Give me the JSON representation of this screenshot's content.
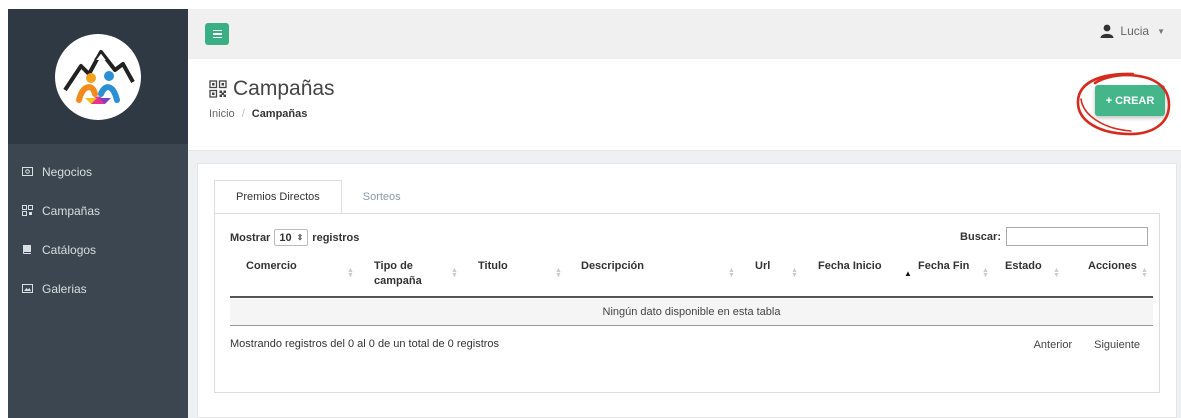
{
  "sidebar": {
    "items": [
      {
        "label": "Negocios",
        "icon": "money-icon"
      },
      {
        "label": "Campañas",
        "icon": "qrcode-icon"
      },
      {
        "label": "Catálogos",
        "icon": "book-icon"
      },
      {
        "label": "Galerias",
        "icon": "image-icon"
      }
    ]
  },
  "topbar": {
    "user_name": "Lucia"
  },
  "header": {
    "title": "Campañas",
    "breadcrumb": [
      "Inicio",
      "Campañas"
    ],
    "breadcrumb_sep": "/",
    "create_button": "+ CREAR"
  },
  "tabs": [
    {
      "label": "Premios Directos",
      "active": true
    },
    {
      "label": "Sorteos",
      "active": false
    }
  ],
  "table": {
    "length_prefix": "Mostrar",
    "length_value": "10",
    "length_suffix": "registros",
    "search_label": "Buscar:",
    "columns": [
      "Comercio",
      "Tipo de campaña",
      "Titulo",
      "Descripción",
      "Url",
      "Fecha Inicio",
      "Fecha Fin",
      "Estado",
      "Acciones"
    ],
    "empty_message": "Ningún dato disponible en esta tabla",
    "info": "Mostrando registros del 0 al 0 de un total de 0 registros",
    "prev": "Anterior",
    "next": "Siguiente"
  },
  "colors": {
    "sidebar": "#3b4650",
    "accent": "#45b58a",
    "highlight_circle": "#d52b1e"
  }
}
